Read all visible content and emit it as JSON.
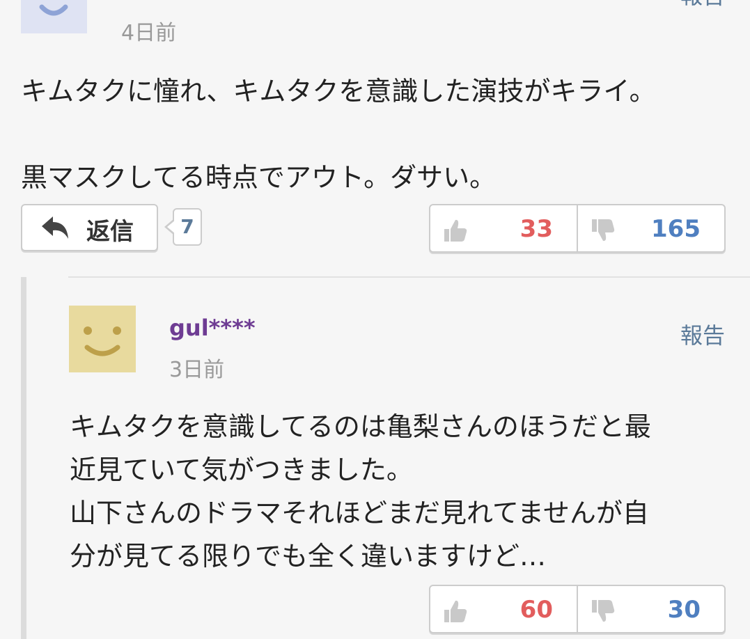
{
  "comment": {
    "timestamp": "4日前",
    "report_label": "報告",
    "body": "キムタクに憧れ、キムタクを意識した演技がキライ。\n\n黒マスクしてる時点でアウト。ダサい。",
    "reply_label": "返信",
    "reply_count": "7",
    "good_count": "33",
    "bad_count": "165"
  },
  "reply": {
    "username": "gul****",
    "timestamp": "3日前",
    "report_label": "報告",
    "body": "キムタクを意識してるのは亀梨さんのほうだと最\n近見ていて気がつきました。\n山下さんのドラマそれほどまだ見れてませんが自\n分が見てる限りでも全く違いますけど…",
    "good_count": "60",
    "bad_count": "30"
  },
  "icons": {
    "reply": "reply-arrow-icon",
    "good": "thumbs-up-icon",
    "bad": "thumbs-down-icon",
    "avatar": "smiley-face-icon"
  },
  "colors": {
    "good": "#e25d5d",
    "bad": "#4f7fc0",
    "username": "#6e3c93",
    "link": "#5b7a99"
  }
}
